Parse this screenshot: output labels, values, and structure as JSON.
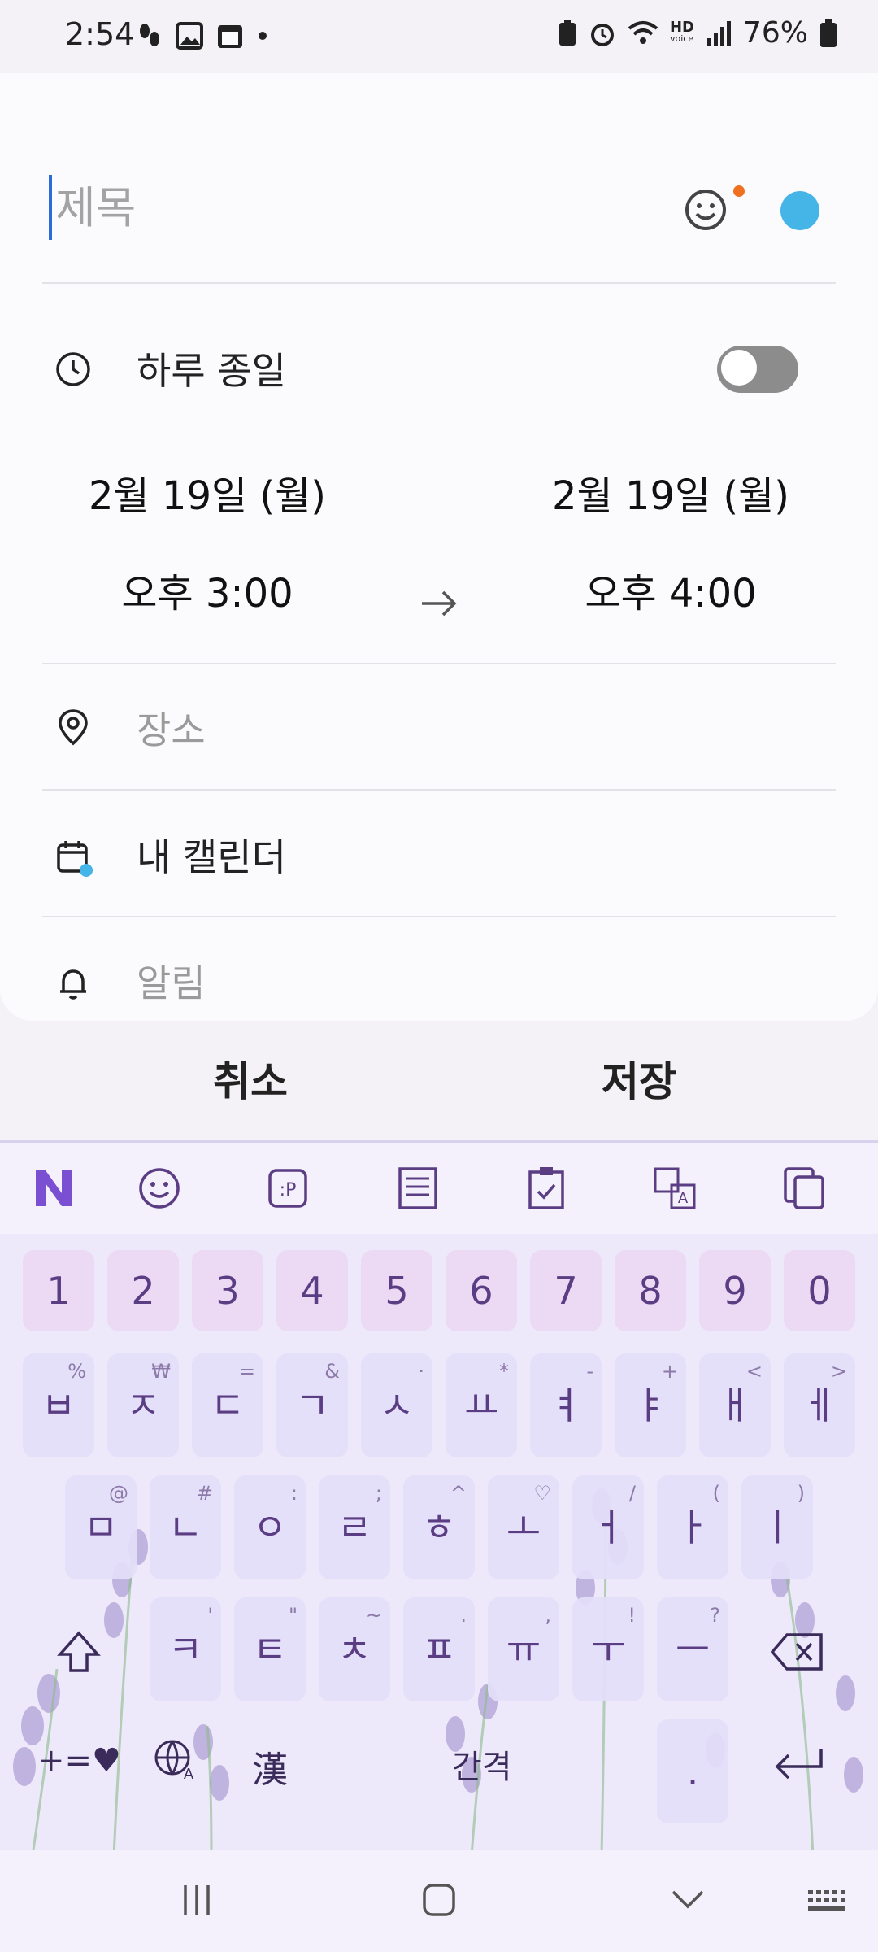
{
  "status_bar": {
    "time": "2:54",
    "battery": "76%",
    "left_icons": [
      "steps-icon",
      "gallery-icon",
      "calendar-icon",
      "dot-icon"
    ],
    "right_icons": [
      "battery-saver-icon",
      "alarm-icon",
      "wifi-icon",
      "hd-voice-icon",
      "signal-icon",
      "battery-icon"
    ],
    "hd_label": "HD",
    "voice_label": "voice"
  },
  "event": {
    "title_placeholder": "제목",
    "color": "#45b4e6",
    "all_day_label": "하루 종일",
    "all_day_on": false,
    "start_date": "2월 19일 (월)",
    "start_time": "오후 3:00",
    "end_date": "2월 19일 (월)",
    "end_time": "오후 4:00",
    "location_placeholder": "장소",
    "calendar_label": "내 캘린더",
    "alert_placeholder": "알림"
  },
  "actions": {
    "cancel": "취소",
    "save": "저장"
  },
  "keyboard": {
    "toolbar_icons": [
      "n-logo-icon",
      "emoji-icon",
      "sticker-icon",
      "text-icon",
      "clipboard-icon",
      "translate-icon",
      "copy-icon"
    ],
    "number_row": [
      "1",
      "2",
      "3",
      "4",
      "5",
      "6",
      "7",
      "8",
      "9",
      "0"
    ],
    "row1": [
      {
        "k": "ㅂ",
        "s": "%"
      },
      {
        "k": "ㅈ",
        "s": "₩"
      },
      {
        "k": "ㄷ",
        "s": "="
      },
      {
        "k": "ㄱ",
        "s": "&"
      },
      {
        "k": "ㅅ",
        "s": "·"
      },
      {
        "k": "ㅛ",
        "s": "*"
      },
      {
        "k": "ㅕ",
        "s": "-"
      },
      {
        "k": "ㅑ",
        "s": "+"
      },
      {
        "k": "ㅐ",
        "s": "<"
      },
      {
        "k": "ㅔ",
        "s": ">"
      }
    ],
    "row2": [
      {
        "k": "ㅁ",
        "s": "@"
      },
      {
        "k": "ㄴ",
        "s": "#"
      },
      {
        "k": "ㅇ",
        "s": ":"
      },
      {
        "k": "ㄹ",
        "s": ";"
      },
      {
        "k": "ㅎ",
        "s": "^"
      },
      {
        "k": "ㅗ",
        "s": "♡"
      },
      {
        "k": "ㅓ",
        "s": "/"
      },
      {
        "k": "ㅏ",
        "s": "("
      },
      {
        "k": "ㅣ",
        "s": ")"
      }
    ],
    "row3": [
      {
        "k": "ㅋ",
        "s": "'"
      },
      {
        "k": "ㅌ",
        "s": "\""
      },
      {
        "k": "ㅊ",
        "s": "~"
      },
      {
        "k": "ㅍ",
        "s": "."
      },
      {
        "k": "ㅠ",
        "s": ","
      },
      {
        "k": "ㅜ",
        "s": "!"
      },
      {
        "k": "ㅡ",
        "s": "?"
      }
    ],
    "symbols_key": "+=♥",
    "hanja_key": "漢",
    "space_key": "간격",
    "period_key": "."
  }
}
